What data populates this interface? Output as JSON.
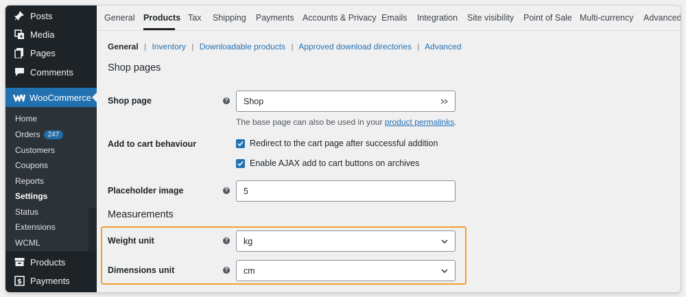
{
  "sidebar": {
    "items_top": [
      {
        "label": "Posts",
        "icon": "pin-icon"
      },
      {
        "label": "Media",
        "icon": "media-icon"
      },
      {
        "label": "Pages",
        "icon": "pages-icon"
      },
      {
        "label": "Comments",
        "icon": "comment-icon"
      }
    ],
    "woocommerce": "WooCommerce",
    "submenu": [
      {
        "label": "Home"
      },
      {
        "label": "Orders",
        "badge": "247"
      },
      {
        "label": "Customers"
      },
      {
        "label": "Coupons"
      },
      {
        "label": "Reports"
      },
      {
        "label": "Settings",
        "current": true
      },
      {
        "label": "Status"
      },
      {
        "label": "Extensions"
      },
      {
        "label": "WCML"
      }
    ],
    "items_bottom": [
      {
        "label": "Products",
        "icon": "archive-icon"
      },
      {
        "label": "Payments",
        "icon": "dollar-icon"
      }
    ]
  },
  "tabs": [
    "General",
    "Products",
    "Tax",
    "Shipping",
    "Payments",
    "Accounts & Privacy",
    "Emails",
    "Integration",
    "Site visibility",
    "Point of Sale",
    "Multi-currency",
    "Advanced"
  ],
  "active_tab": "Products",
  "subnav": {
    "current": "General",
    "links": [
      "Inventory",
      "Downloadable products",
      "Approved download directories",
      "Advanced"
    ],
    "separator": "|"
  },
  "shop_pages": {
    "heading": "Shop pages",
    "shop_page_label": "Shop page",
    "shop_page_value": "Shop",
    "shop_page_desc_prefix": "The base page can also be used in your ",
    "shop_page_desc_link": "product permalinks",
    "shop_page_desc_suffix": ".",
    "cart_label": "Add to cart behaviour",
    "cart_option_1": "Redirect to the cart page after successful addition",
    "cart_option_2": "Enable AJAX add to cart buttons on archives",
    "placeholder_label": "Placeholder image",
    "placeholder_value": "5"
  },
  "measurements": {
    "heading": "Measurements",
    "weight_label": "Weight unit",
    "weight_value": "kg",
    "dimensions_label": "Dimensions unit",
    "dimensions_value": "cm"
  },
  "colors": {
    "sidebar_bg": "#1d2327",
    "accent": "#2271b1",
    "highlight": "#f0a030"
  }
}
